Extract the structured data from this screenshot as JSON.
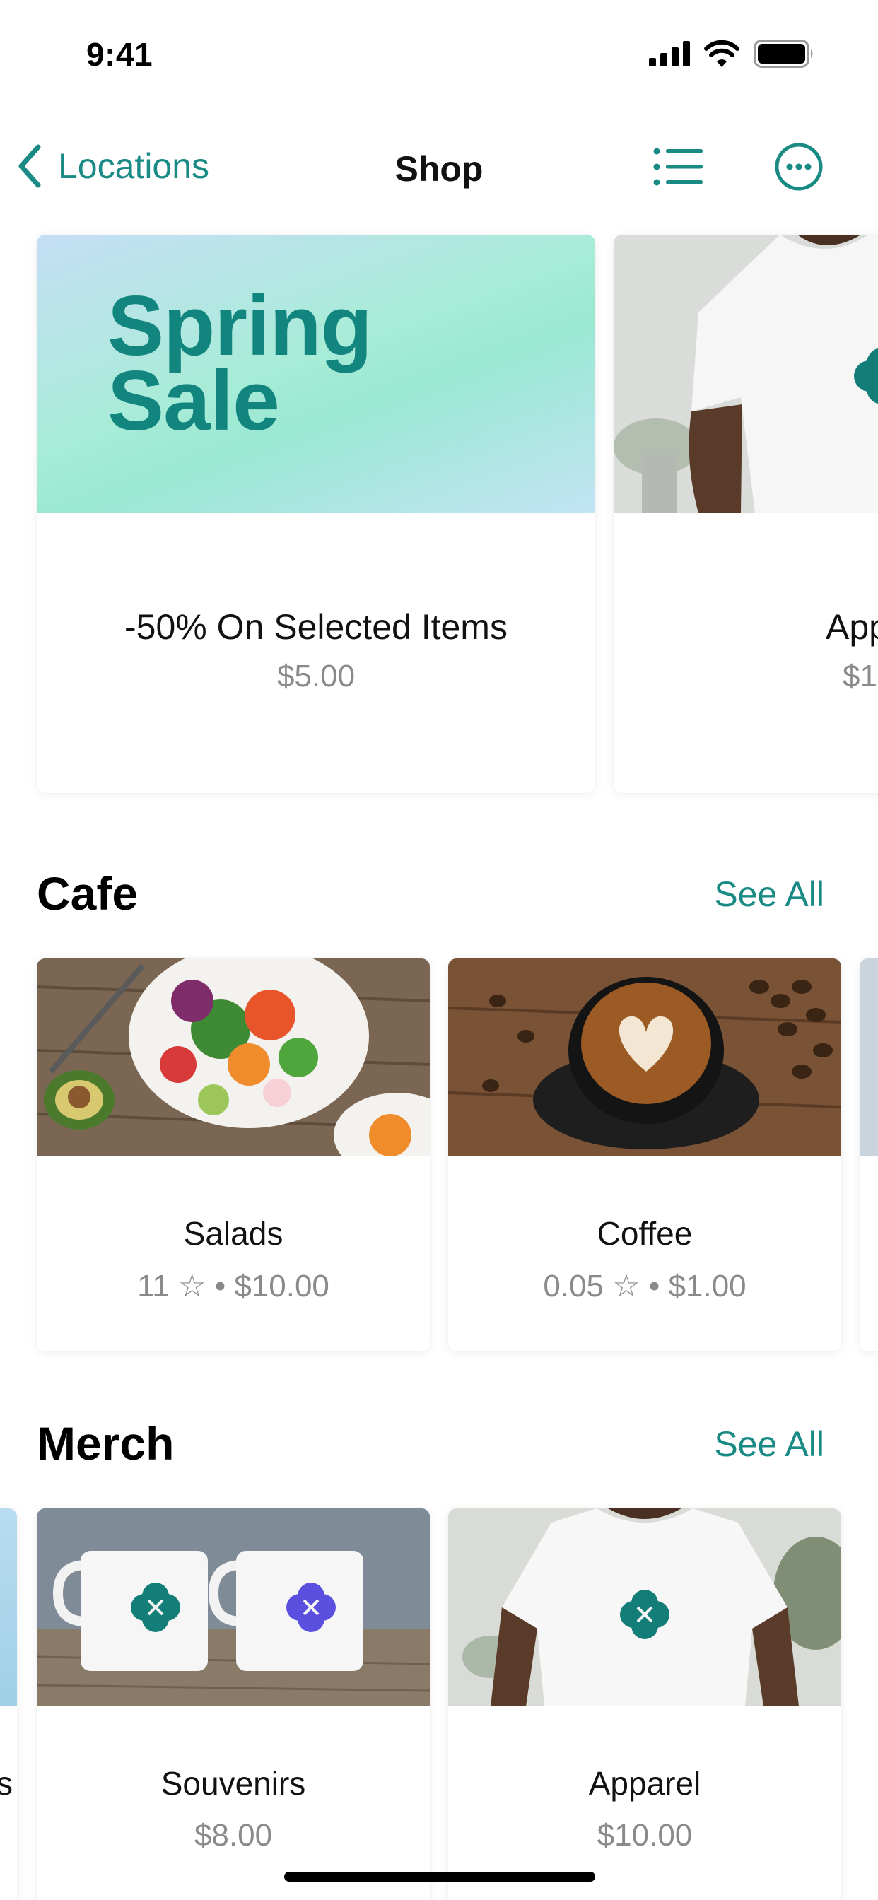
{
  "status_bar": {
    "time": "9:41",
    "icons": [
      "cellular-signal-icon",
      "wifi-icon",
      "battery-icon"
    ]
  },
  "nav": {
    "back_label": "Locations",
    "title": "Shop",
    "icons": [
      "chevron-left-icon",
      "list-icon",
      "more-icon"
    ]
  },
  "featured": [
    {
      "banner_text": "Spring Sale",
      "banner_line1": "Spring",
      "banner_line2": "Sale",
      "title": "-50% On Selected Items",
      "price": "$5.00"
    },
    {
      "title": "App",
      "price": "$1"
    }
  ],
  "sections": [
    {
      "title": "Cafe",
      "see_all": "See All",
      "items": [
        {
          "title": "Salads",
          "rating": "11",
          "price": "$10.00"
        },
        {
          "title": "Coffee",
          "rating": "0.05",
          "price": "$1.00"
        }
      ]
    },
    {
      "title": "Merch",
      "see_all": "See All",
      "items": [
        {
          "title": "Souvenirs",
          "price": "$8.00"
        },
        {
          "title": "Apparel",
          "price": "$10.00"
        }
      ]
    }
  ],
  "colors": {
    "accent": "#1a8a85",
    "banner_gradient_start": "#8fe8cc",
    "banner_gradient_end": "#c9ddf7",
    "secondary_text": "#8a8a8a",
    "souvenir_logo_purple": "#5b4fe0"
  },
  "rating_separator": "☆ •"
}
